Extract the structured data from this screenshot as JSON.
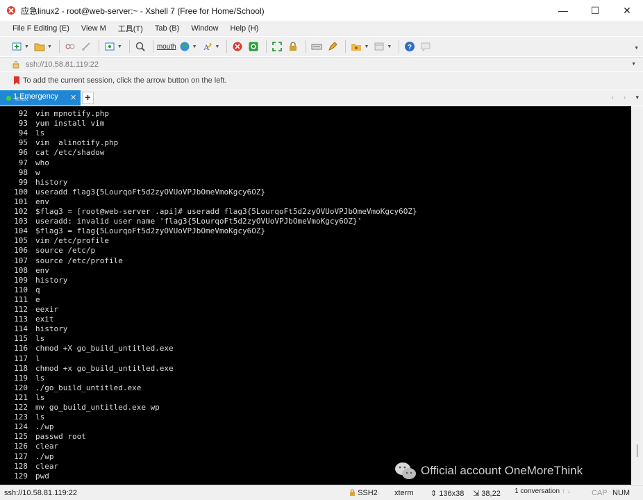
{
  "window": {
    "title": "应急linux2 - root@web-server:~ - Xshell 7 (Free for Home/School)",
    "controls": {
      "minimize": "—",
      "maximize": "☐",
      "close": "✕"
    }
  },
  "menu": {
    "items": [
      "File F Editing (E)",
      "View M",
      "工具(T)",
      "Tab (B)",
      "Window",
      "Help (H)"
    ]
  },
  "toolbar": {
    "font_label": "mouth",
    "icons": [
      "new-session-icon",
      "open-folder-icon",
      "connect-icon",
      "disconnect-icon",
      "reconnect-icon",
      "search-icon",
      "globe-icon",
      "font-icon",
      "xftp-icon",
      "xftp-green-icon",
      "fullscreen-icon",
      "lock-icon",
      "keyboard-icon",
      "pen-icon",
      "add-folder-icon",
      "layout-icon",
      "help-icon",
      "chat-icon"
    ]
  },
  "address": {
    "value": "ssh://10.58.81.119:22"
  },
  "info": {
    "hint": "To add the current session, click the arrow button on the left."
  },
  "tabs": [
    {
      "label": "1 Emergency",
      "sublabel": "linux"
    }
  ],
  "tabbar": {
    "new_tab": "+",
    "nav": "‹ ›",
    "menu": "▾"
  },
  "terminal": {
    "lines": [
      {
        "n": "92",
        "cmd": "vim mpnotify.php"
      },
      {
        "n": "93",
        "cmd": "yum install vim"
      },
      {
        "n": "94",
        "cmd": "ls"
      },
      {
        "n": "95",
        "cmd": "vim  alinotify.php"
      },
      {
        "n": "96",
        "cmd": "cat /etc/shadow"
      },
      {
        "n": "97",
        "cmd": "who"
      },
      {
        "n": "98",
        "cmd": "w"
      },
      {
        "n": "99",
        "cmd": "history"
      },
      {
        "n": "100",
        "cmd": "useradd flag3{5LourqoFt5d2zyOVUoVPJbOmeVmoKgcy6OZ}"
      },
      {
        "n": "101",
        "cmd": "env"
      },
      {
        "n": "102",
        "cmd": "$flag3 = [root@web-server .api]# useradd flag3{5LourqoFt5d2zyOVUoVPJbOmeVmoKgcy6OZ}"
      },
      {
        "n": "103",
        "cmd": "useradd: invalid user name 'flag3{5LourqoFt5d2zyOVUoVPJbOmeVmoKgcy6OZ}'"
      },
      {
        "n": "104",
        "cmd": "$flag3 = flag{5LourqoFt5d2zyOVUoVPJbOmeVmoKgcy6OZ}"
      },
      {
        "n": "105",
        "cmd": "vim /etc/profile"
      },
      {
        "n": "106",
        "cmd": "source /etc/p"
      },
      {
        "n": "107",
        "cmd": "source /etc/profile"
      },
      {
        "n": "108",
        "cmd": "env"
      },
      {
        "n": "109",
        "cmd": "history"
      },
      {
        "n": "110",
        "cmd": "q"
      },
      {
        "n": "111",
        "cmd": "e"
      },
      {
        "n": "112",
        "cmd": "eexir"
      },
      {
        "n": "113",
        "cmd": "exit"
      },
      {
        "n": "114",
        "cmd": "history"
      },
      {
        "n": "115",
        "cmd": "ls"
      },
      {
        "n": "116",
        "cmd": "chmod +X go_build_untitled.exe"
      },
      {
        "n": "117",
        "cmd": "l"
      },
      {
        "n": "118",
        "cmd": "chmod +x go_build_untitled.exe"
      },
      {
        "n": "119",
        "cmd": "ls"
      },
      {
        "n": "120",
        "cmd": "./go_build_untitled.exe"
      },
      {
        "n": "121",
        "cmd": "ls"
      },
      {
        "n": "122",
        "cmd": "mv go_build_untitled.exe wp"
      },
      {
        "n": "123",
        "cmd": "ls"
      },
      {
        "n": "124",
        "cmd": "./wp"
      },
      {
        "n": "125",
        "cmd": "passwd root"
      },
      {
        "n": "126",
        "cmd": "clear"
      },
      {
        "n": "127",
        "cmd": "./wp"
      },
      {
        "n": "128",
        "cmd": "clear"
      },
      {
        "n": "129",
        "cmd": "pwd"
      }
    ]
  },
  "watermark": {
    "text": "Official account OneMoreThink"
  },
  "status": {
    "address": "ssh://10.58.81.119:22",
    "protocol": "SSH2",
    "terminal_type": "xterm",
    "size": "136x38",
    "cursor": "38,22",
    "conversations": "1 conversation",
    "cap": "CAP",
    "num": "NUM"
  },
  "colors": {
    "tab_active": "#1e88d6",
    "terminal_bg": "#000000",
    "terminal_fg": "#dcdcdc",
    "chrome": "#f0f0f0"
  }
}
